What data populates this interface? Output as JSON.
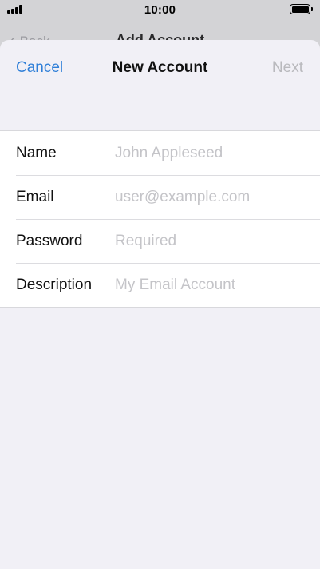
{
  "status_bar": {
    "time": "10:00",
    "signal-icon": "cellular-signal-icon",
    "battery-icon": "battery-full-icon"
  },
  "background_nav": {
    "back_label": "Back",
    "title": "Add Account",
    "back-icon": "chevron-left-icon"
  },
  "sheet": {
    "cancel_label": "Cancel",
    "title": "New Account",
    "next_label": "Next",
    "next_enabled": false
  },
  "form": {
    "fields": [
      {
        "label": "Name",
        "value": "",
        "placeholder": "John Appleseed"
      },
      {
        "label": "Email",
        "value": "",
        "placeholder": "user@example.com"
      },
      {
        "label": "Password",
        "value": "",
        "placeholder": "Required"
      },
      {
        "label": "Description",
        "value": "",
        "placeholder": "My Email Account"
      }
    ]
  },
  "colors": {
    "accent": "#2f7fd8",
    "disabled": "#b9b9bd",
    "sheet_background": "#f1f0f6",
    "placeholder": "#c4c4c8"
  }
}
